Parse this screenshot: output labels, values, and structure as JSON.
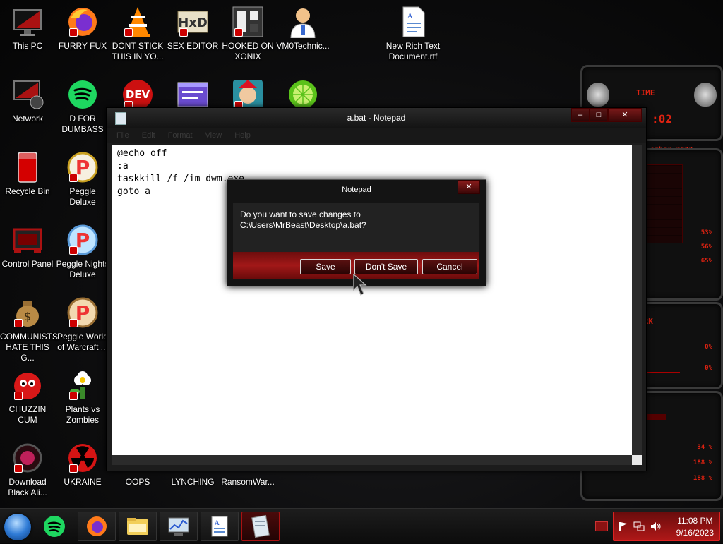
{
  "desktop": {
    "icons": [
      {
        "label": "This PC"
      },
      {
        "label": "FURRY FUX"
      },
      {
        "label": "DONT STICK THIS IN YO..."
      },
      {
        "label": "SEX EDITOR"
      },
      {
        "label": "HOOKED ON XONIX"
      },
      {
        "label": "VM0Technic..."
      },
      {
        "label": "New Rich Text Document.rtf"
      },
      {
        "label": "Network"
      },
      {
        "label": "D FOR DUMBASS"
      },
      {
        "label": "Recycle Bin"
      },
      {
        "label": "Peggle Deluxe"
      },
      {
        "label": "Control Panel"
      },
      {
        "label": "Peggle Nights Deluxe"
      },
      {
        "label": "COMMUNISTS HATE THIS G..."
      },
      {
        "label": "Peggle World of Warcraft ..."
      },
      {
        "label": "CHUZZIN CUM"
      },
      {
        "label": "Plants vs Zombies"
      },
      {
        "label": "Download Black Ali..."
      },
      {
        "label": "UKRAINE"
      },
      {
        "label": "OOPS"
      },
      {
        "label": "LYNCHING"
      },
      {
        "label": "RansomWar..."
      }
    ],
    "partial_icons": [
      "DEV C++ icon",
      "form icon",
      "elf icon",
      "lime icon"
    ]
  },
  "gadget": {
    "time_label": "TIME",
    "time_value": ":02",
    "date_value": "ember 2023",
    "cpu": [
      "53%",
      "56%",
      "65%"
    ],
    "network_label": "ORK",
    "network": [
      "0%",
      "0%"
    ],
    "disk": [
      "34 %",
      "188 %",
      "188 %"
    ]
  },
  "notepad": {
    "title": "a.bat - Notepad",
    "menu": [
      "File",
      "Edit",
      "Format",
      "View",
      "Help"
    ],
    "content": "@echo off\n:a\ntaskkill /f /im dwm.exe\ngoto a"
  },
  "dialog": {
    "title": "Notepad",
    "message_line1": "Do you want to save changes to",
    "message_line2": "C:\\Users\\MrBeast\\Desktop\\a.bat?",
    "save": "Save",
    "dont_save": "Don't Save",
    "cancel": "Cancel"
  },
  "taskbar": {
    "time": "11:08 PM",
    "date": "9/16/2023"
  },
  "colors": {
    "accent": "#b01818",
    "dark": "#141414"
  }
}
